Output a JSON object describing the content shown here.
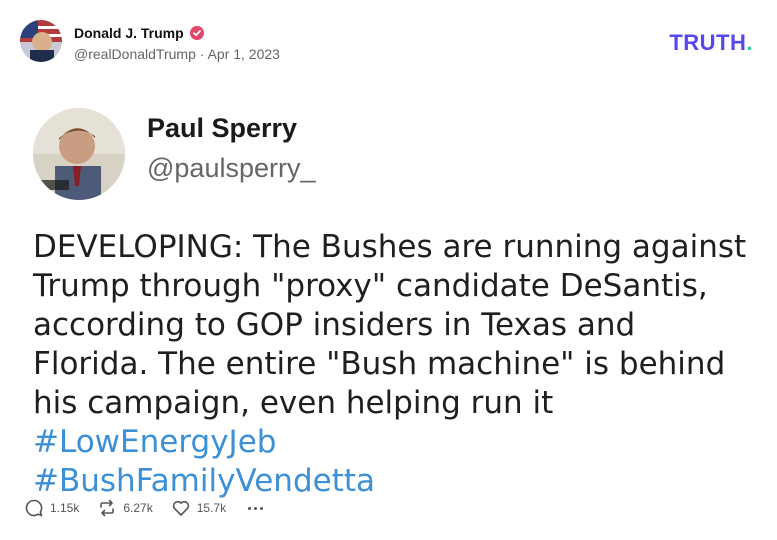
{
  "post": {
    "author_name": "Donald J. Trump",
    "handle": "@realDonaldTrump",
    "separator": "·",
    "date": "Apr 1, 2023"
  },
  "brand": {
    "logo_text": "TRUTH",
    "logo_dot": ".",
    "primary_color": "#5448ee",
    "dot_color": "#2fd0a8"
  },
  "embedded": {
    "name": "Paul Sperry",
    "handle": "@paulsperry_",
    "text_main": "DEVELOPING: The Bushes are running against Trump through \"proxy\" candidate DeSantis, according to GOP insiders in Texas and Florida. The entire \"Bush machine\" is behind his campaign, even helping run it ",
    "hashtag_1": "#LowEnergyJeb",
    "hashtag_2": "#BushFamilyVendetta",
    "hashtag_color": "#3d8fd6"
  },
  "actions": {
    "replies": "1.15k",
    "retruths": "6.27k",
    "likes": "15.7k"
  },
  "icons": [
    "verified-badge-icon",
    "reply-icon",
    "retruth-icon",
    "like-icon",
    "more-icon"
  ]
}
